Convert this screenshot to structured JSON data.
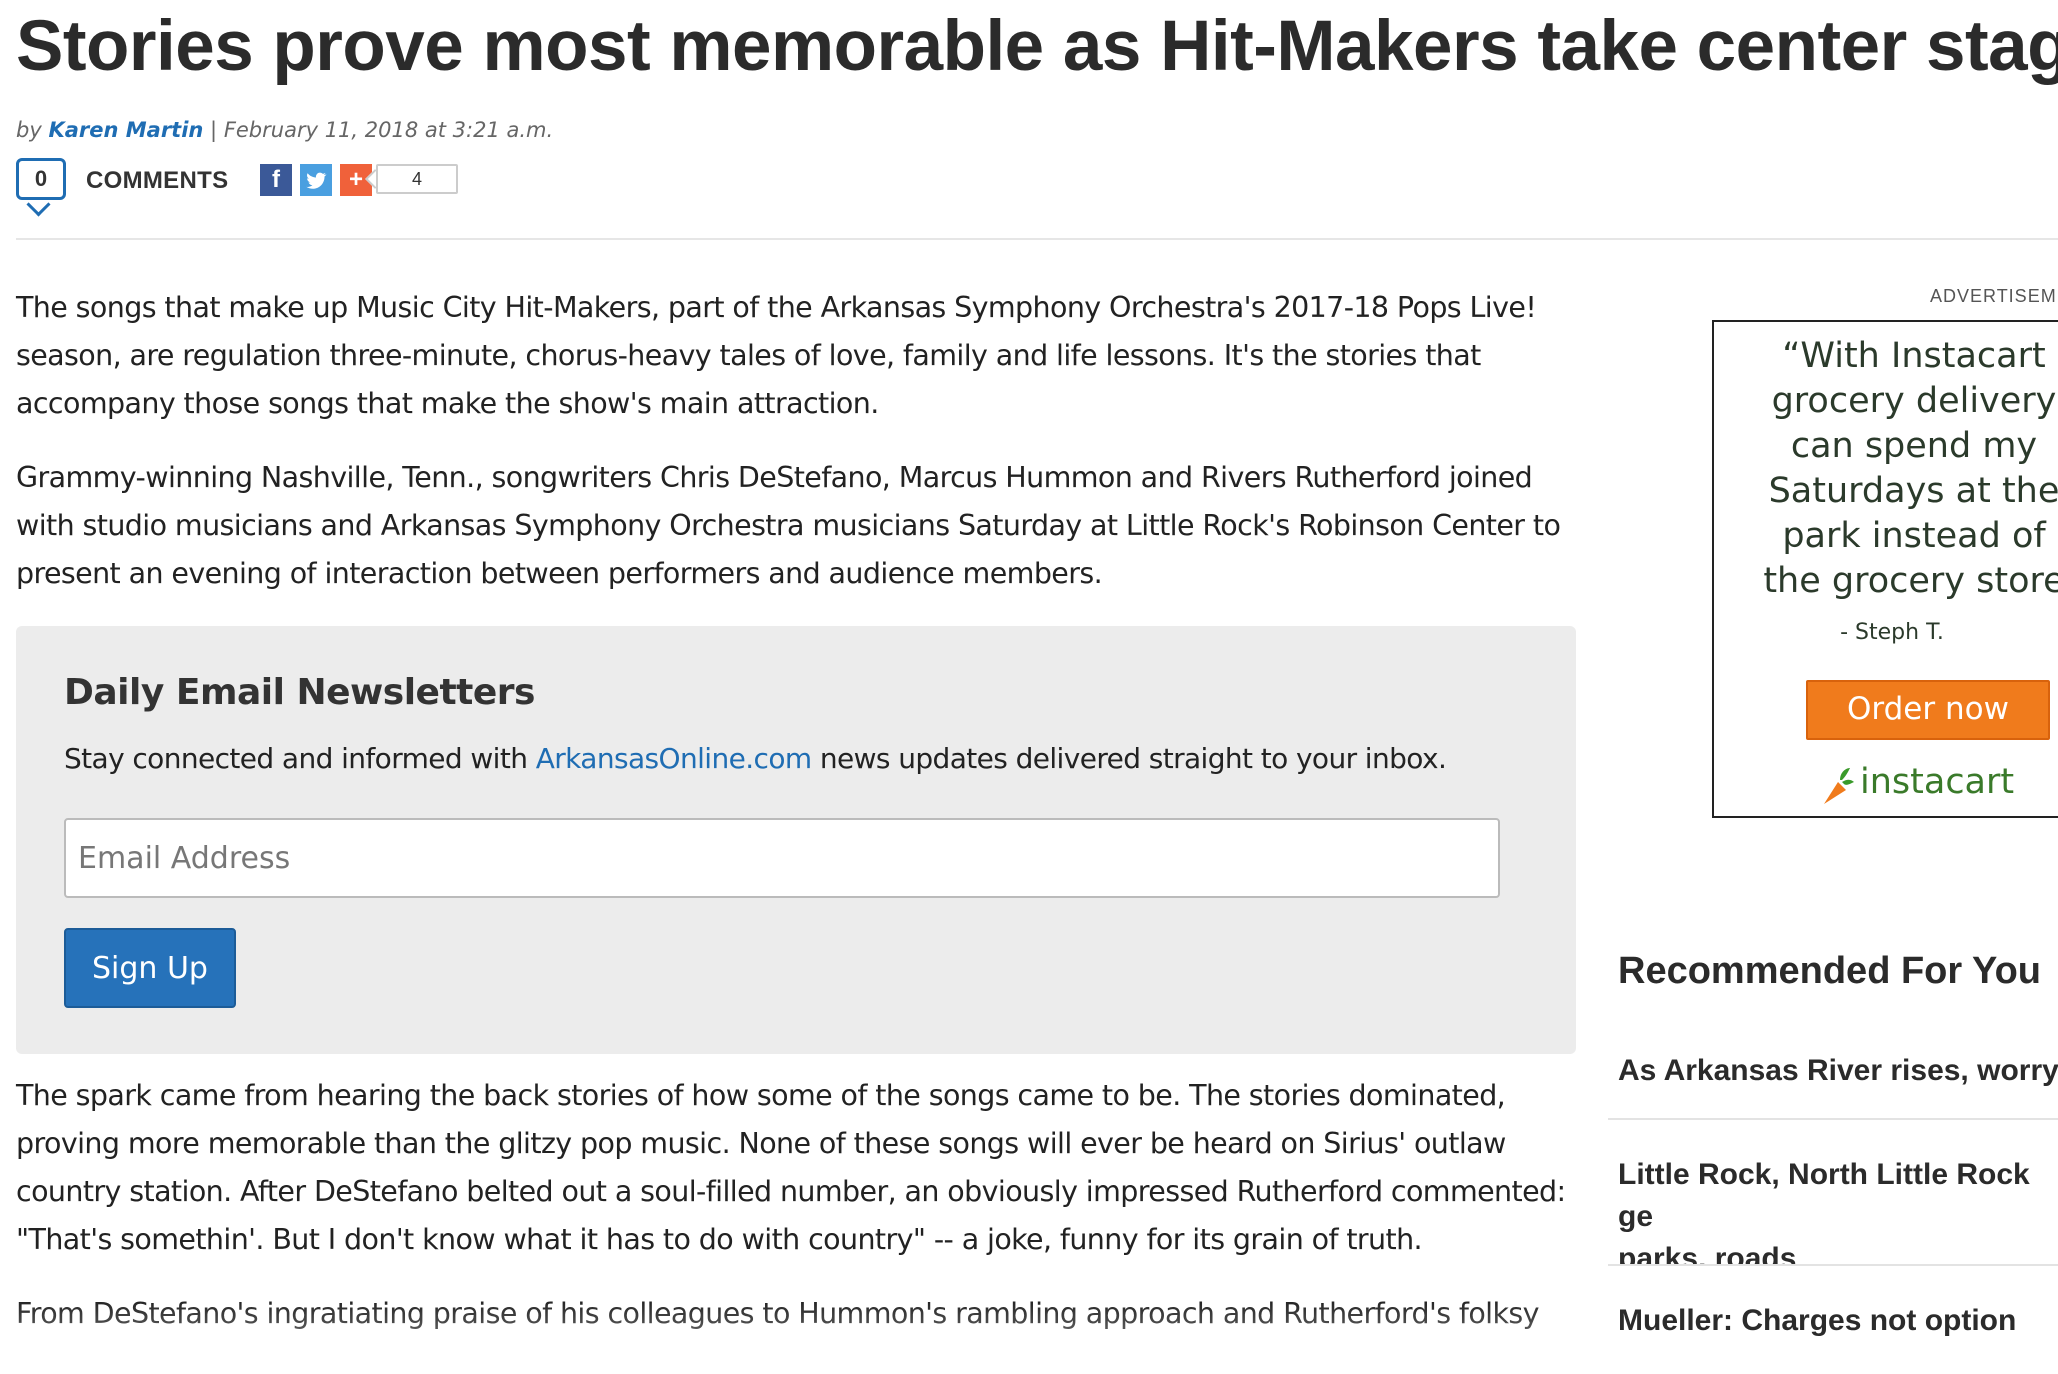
{
  "article": {
    "headline": "Stories prove most memorable as Hit-Makers take center stage",
    "byline_prefix": "by",
    "author": "Karen Martin",
    "byline_sep": " | ",
    "date": "February 11, 2018 at 3:21 a.m.",
    "comments_count": "0",
    "comments_label": "COMMENTS",
    "share_count": "4",
    "paragraphs": [
      "The songs that make up Music City Hit-Makers, part of the Arkansas Symphony Orchestra's 2017-18 Pops Live! season, are regulation three-minute, chorus-heavy tales of love, family and life lessons. It's the stories that accompany those songs that make the show's main attraction.",
      "Grammy-winning Nashville, Tenn., songwriters Chris DeStefano, Marcus Hummon and Rivers Rutherford joined with studio musicians and Arkansas Symphony Orchestra musicians Saturday at Little Rock's Robinson Center to present an evening of interaction between performers and audience members."
    ],
    "paragraphs_after": [
      "The spark came from hearing the back stories of how some of the songs came to be. The stories dominated, proving more memorable than the glitzy pop music. None of these songs will ever be heard on Sirius' outlaw country station. After DeStefano belted out a soul-filled number, an obviously impressed Rutherford commented: \"That's somethin'. But I don't know what it has to do with country\" -- a joke, funny for its grain of truth.",
      "From DeStefano's ingratiating praise of his colleagues to Hummon's rambling approach and Rutherford's folksy"
    ]
  },
  "newsletter": {
    "title": "Daily Email Newsletters",
    "blurb_before": "Stay connected and informed with ",
    "blurb_link": "ArkansasOnline.com",
    "blurb_after": " news updates delivered straight to your inbox.",
    "email_placeholder": "Email Address",
    "signup_label": "Sign Up"
  },
  "ad": {
    "label": "ADVERTISEMENT",
    "quote": "“With Instacart\ngrocery delivery\ncan spend my\nSaturdays at the\npark instead of\nthe grocery store",
    "attribution": "- Steph T.",
    "cta": "Order now",
    "brand": "instacart"
  },
  "recommended": {
    "title": "Recommended For You",
    "items": [
      "As Arkansas River rises, worry",
      "Little Rock, North Little Rock ge\nparks, roads",
      "Mueller: Charges not option"
    ]
  },
  "colors": {
    "link": "#1f6db3",
    "signup_button": "#2672ba",
    "ad_cta": "#f07b1c",
    "ad_brand": "#3a7a2a"
  },
  "icons": {
    "facebook": "facebook-icon",
    "twitter": "twitter-icon",
    "plus": "plus-icon",
    "comment": "comment-bubble-icon",
    "carrot": "carrot-icon"
  }
}
